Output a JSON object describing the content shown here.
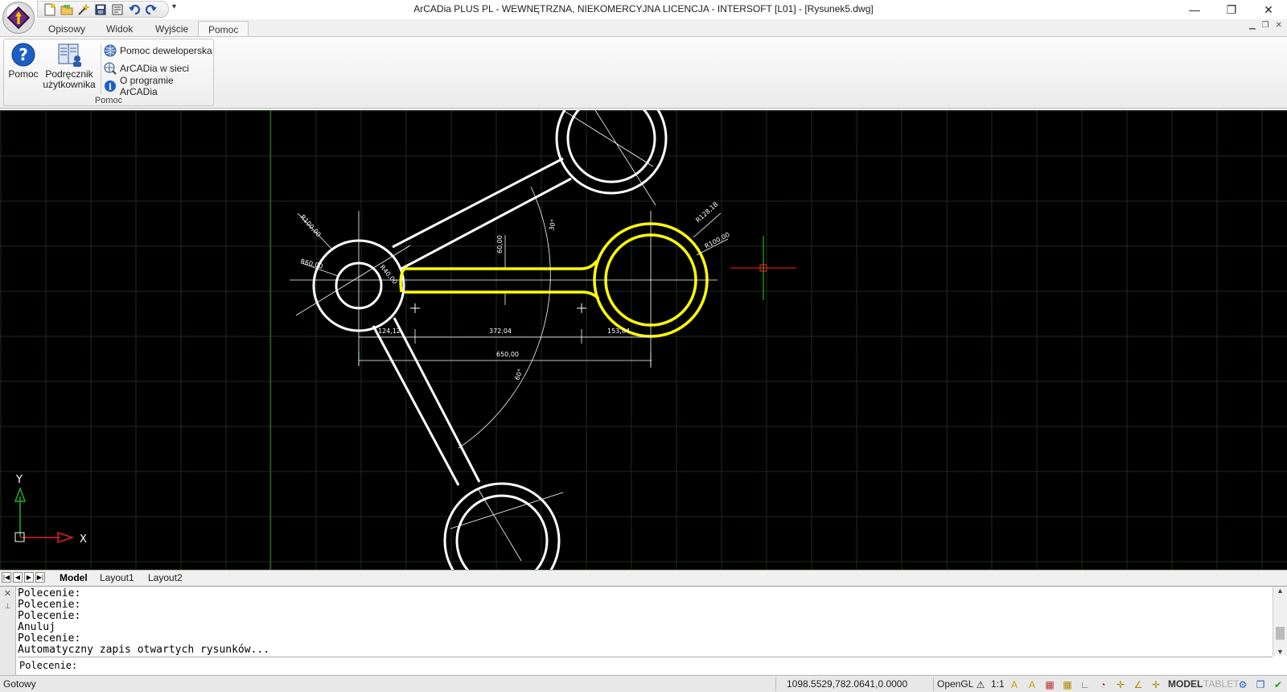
{
  "window": {
    "title": "ArCADia PLUS PL - WEWNĘTRZNA, NIEKOMERCYJNA LICENCJA - INTERSOFT [L01] - [Rysunek5.dwg]",
    "minimize": "—",
    "restore": "❐",
    "close": "✕"
  },
  "qat": {
    "icons": [
      "new-file-icon",
      "open-file-icon",
      "magic-wand-icon",
      "save-icon",
      "save-as-icon",
      "undo-icon",
      "redo-icon"
    ],
    "more": "▾"
  },
  "ribbon": {
    "tabs": [
      "Opisowy",
      "Widok",
      "Wyjście",
      "Pomoc"
    ],
    "active_tab": "Pomoc",
    "group": {
      "label": "Pomoc",
      "big_buttons": [
        {
          "label1": "Pomoc",
          "label2": ""
        },
        {
          "label1": "Podręcznik",
          "label2": "użytkownika"
        }
      ],
      "small_buttons": [
        "Pomoc deweloperska",
        "ArCADia w sieci",
        "O programie ArCADia"
      ]
    }
  },
  "drawing": {
    "dimensions": [
      "R100,00",
      "R60,00",
      "R40,00",
      "R128,18",
      "R100,00",
      "60,00",
      "30°",
      "124,12",
      "372,04",
      "153,84",
      "650,00",
      "60°"
    ],
    "ucs_x": "X",
    "ucs_y": "Y",
    "colors": {
      "geometry": "#ffffff",
      "selected": "#ffff00",
      "grid": "#1f3a1f",
      "cursor": "#ff2020",
      "axis_y": "#2aa02a"
    }
  },
  "layout_tabs": {
    "tabs": [
      "Model",
      "Layout1",
      "Layout2"
    ],
    "active": "Model"
  },
  "command": {
    "history": [
      "Polecenie:",
      "Polecenie:",
      "Polecenie:",
      "Anuluj",
      "Polecenie:",
      "Automatyczny zapis otwartych rysunków..."
    ],
    "prompt": "Polecenie:"
  },
  "status": {
    "state": "Gotowy",
    "coords": "1098.5529,782.0641,0.0000",
    "renderer": "OpenGL",
    "scale": "1:1",
    "model": "MODEL",
    "tablet": "TABLET"
  }
}
